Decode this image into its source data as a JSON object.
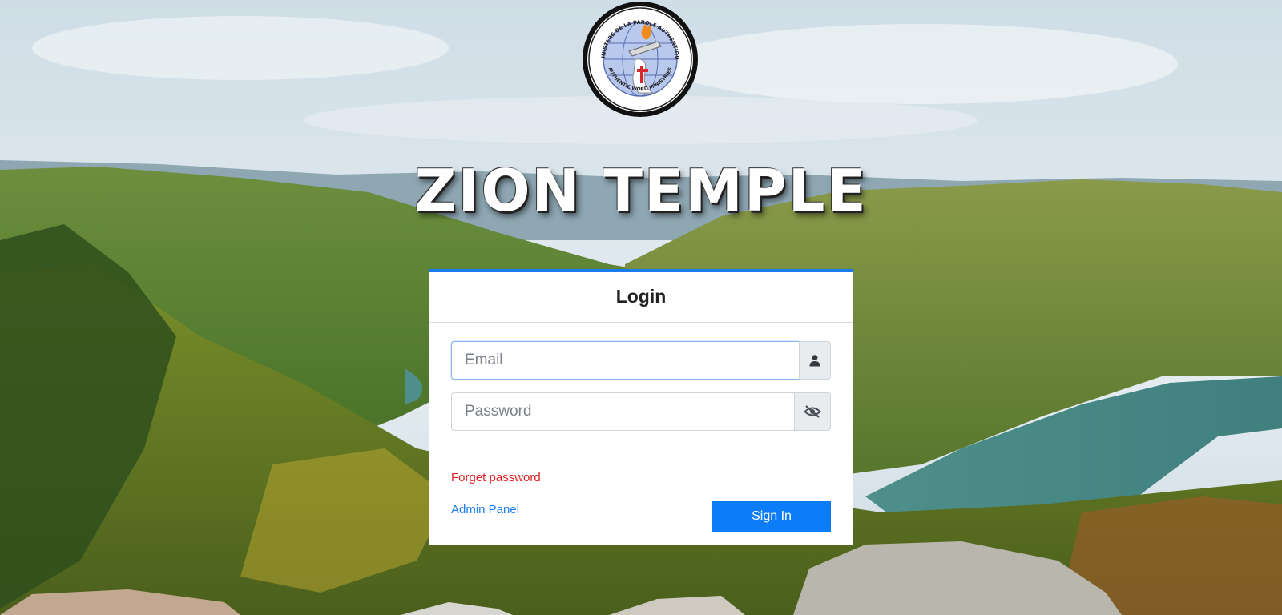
{
  "brand": {
    "seal_text_top": "MINISTERE DE LA PAROLE AUTHENTIQUE",
    "seal_text_bottom": "AUTHENTIC WORD MINISTRIES",
    "title": "ZION TEMPLE"
  },
  "login": {
    "header": "Login",
    "email_placeholder": "Email",
    "email_value": "",
    "email_icon": "user-icon",
    "password_placeholder": "Password",
    "password_value": "",
    "password_icon": "eye-slash-icon",
    "forget_password": "Forget password",
    "admin_panel": "Admin Panel",
    "sign_in": "Sign In"
  },
  "colors": {
    "accent": "#1a7cf0",
    "button": "#0d7cf7",
    "forget_link": "#e02020"
  }
}
